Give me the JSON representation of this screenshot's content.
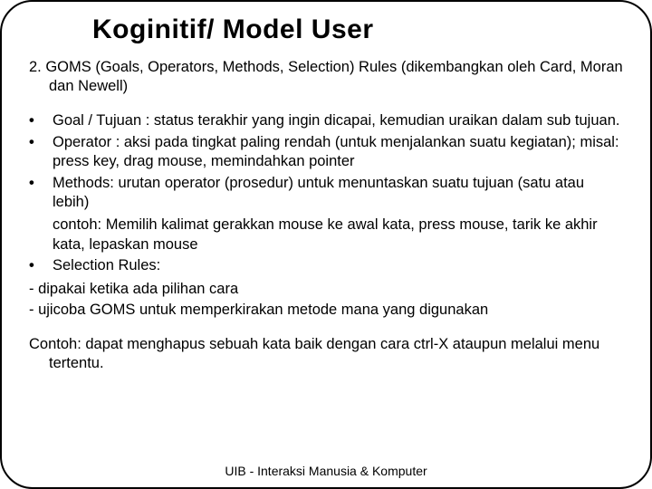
{
  "title": "Koginitif/ Model User",
  "intro": "2. GOMS (Goals, Operators, Methods, Selection) Rules (dikembangkan oleh Card, Moran dan Newell)",
  "bullets": {
    "b1": "Goal / Tujuan : status terakhir yang ingin dicapai, kemudian uraikan dalam sub tujuan.",
    "b2": "Operator : aksi pada tingkat paling rendah (untuk menjalankan suatu kegiatan); misal: press key, drag mouse, memindahkan pointer",
    "b3": "Methods: urutan operator (prosedur) untuk menuntaskan suatu tujuan (satu atau lebih)",
    "b3_sub": " contoh: Memilih kalimat gerakkan mouse ke awal kata, press mouse, tarik ke akhir kata, lepaskan mouse",
    "b4": "Selection Rules:"
  },
  "dashes": {
    "d1": "- dipakai ketika ada pilihan cara",
    "d2": "- ujicoba GOMS untuk memperkirakan metode mana yang digunakan"
  },
  "example": "Contoh: dapat menghapus sebuah kata baik dengan cara ctrl-X ataupun melalui menu tertentu.",
  "footer": "UIB - Interaksi Manusia & Komputer"
}
